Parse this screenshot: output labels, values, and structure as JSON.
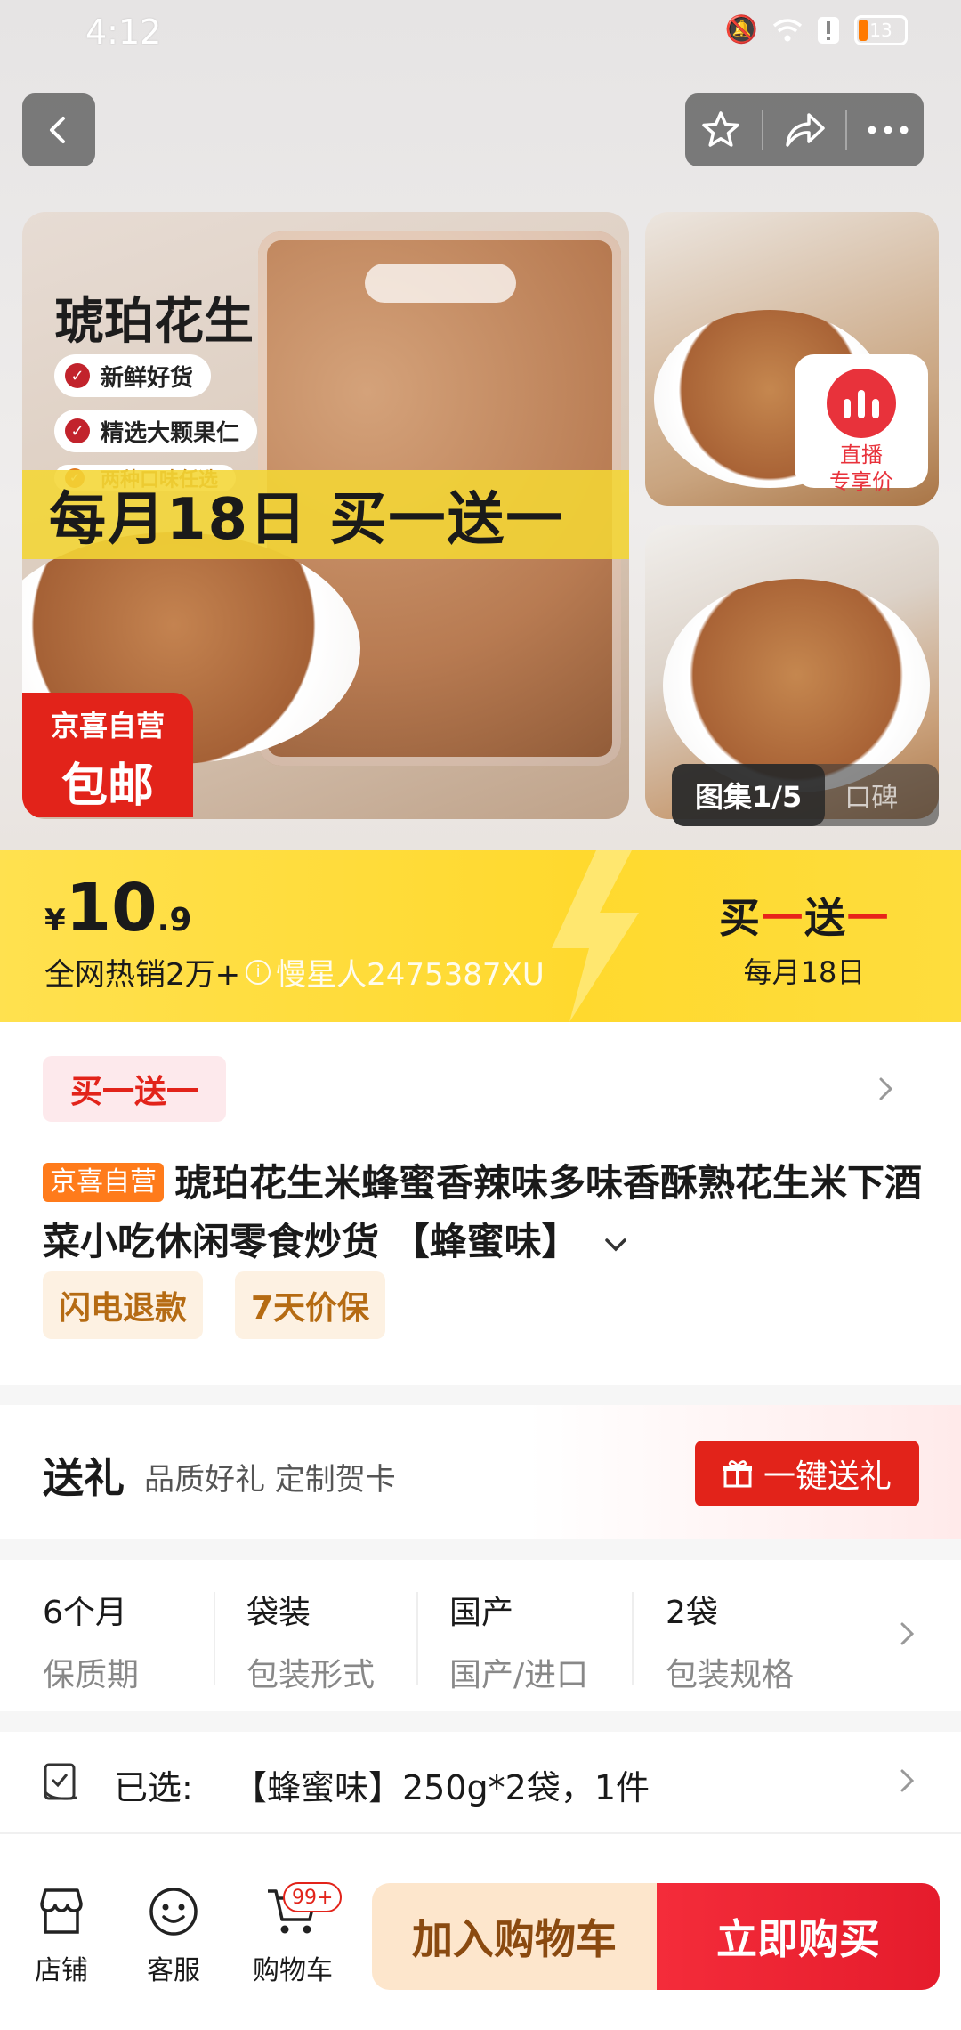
{
  "status_bar": {
    "time": "4:12",
    "battery": "13"
  },
  "gallery": {
    "main_title": "琥珀花生",
    "features": [
      "新鲜好货",
      "精选大颗果仁",
      "两种口味任选"
    ],
    "promo_banner": "每月18日 买一送一",
    "badge_top": "京喜自营",
    "badge_bottom": "包邮",
    "live_badge": [
      "直播",
      "专享价"
    ],
    "tab_active": "图集1/5",
    "tab_inactive": "口碑"
  },
  "price": {
    "currency": "¥",
    "integer": "10",
    "decimal": ".9",
    "hot_sales": "全网热销2万+",
    "watermark_user": "慢星人2475387XU"
  },
  "promo_right": {
    "part1": "买",
    "dash1": "一",
    "part2": "送",
    "dash2": "一",
    "sub": "每月18日"
  },
  "product": {
    "promo_tag": "买一送一",
    "brand_tag": "京喜自营",
    "title": "琥珀花生米蜂蜜香辣味多味香酥熟花生米下酒菜小吃休闲零食炒货 【蜂蜜味】",
    "services": [
      "闪电退款",
      "7天价保"
    ]
  },
  "gift": {
    "title": "送礼",
    "subtitle": "品质好礼 定制贺卡",
    "button": "一键送礼"
  },
  "specs": [
    {
      "value": "6个月",
      "label": "保质期"
    },
    {
      "value": "袋装",
      "label": "包装形式"
    },
    {
      "value": "国产",
      "label": "国产/进口"
    },
    {
      "value": "2袋",
      "label": "包装规格"
    }
  ],
  "selected": {
    "label": "已选:",
    "value": "【蜂蜜味】250g*2袋，1件"
  },
  "bottom_bar": {
    "store": "店铺",
    "service": "客服",
    "cart": "购物车",
    "cart_count": "99+",
    "add_to_cart": "加入购物车",
    "buy_now": "立即购买"
  },
  "colors": {
    "accent_red": "#e2231a",
    "price_yellow": "#ffd92e",
    "brand_orange": "#ff7b1b"
  },
  "icons": [
    "back-icon",
    "star-icon",
    "share-icon",
    "more-icon",
    "chevron-right-icon",
    "gift-icon",
    "checklist-icon",
    "store-icon",
    "service-icon",
    "cart-icon"
  ]
}
